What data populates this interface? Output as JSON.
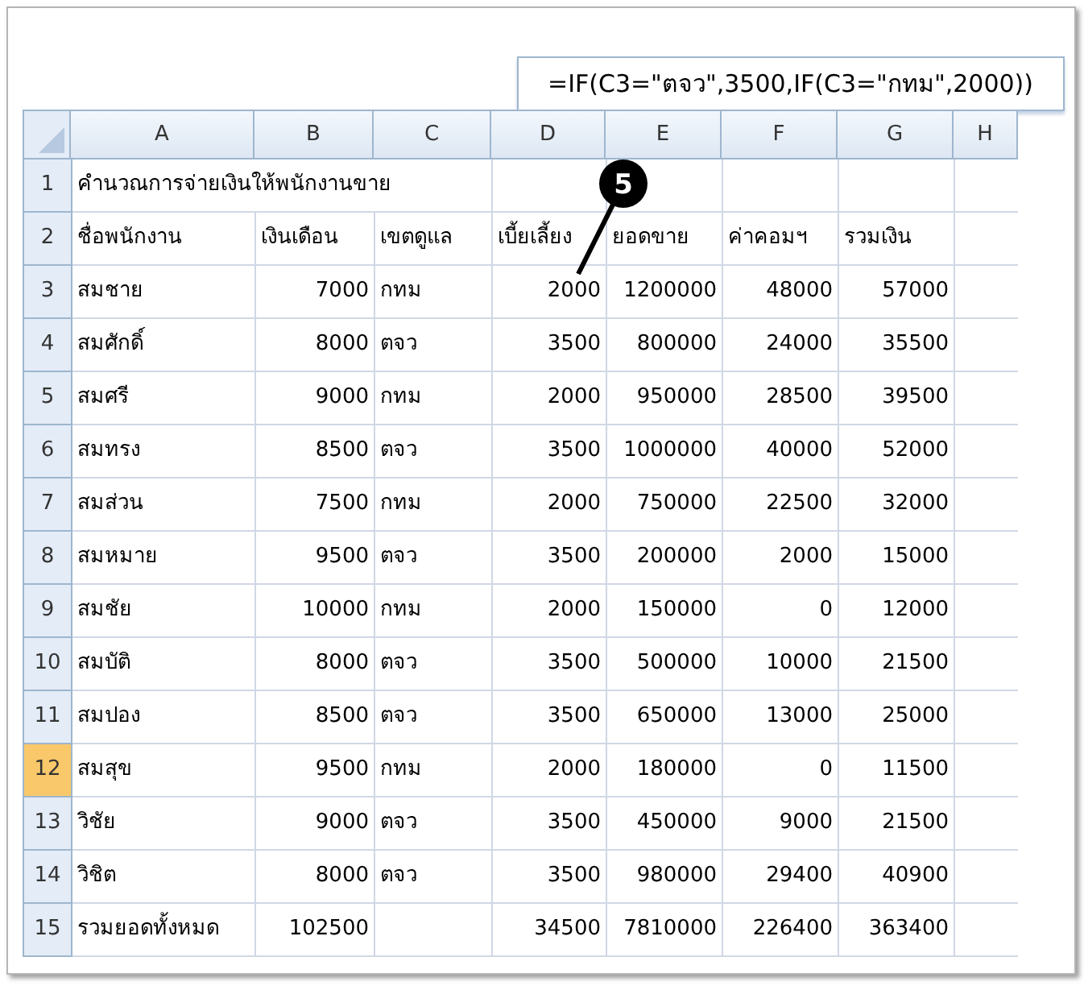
{
  "formula_bar": {
    "formula": "=IF(C3=\"ตจว\",3500,IF(C3=\"กทม\",2000))"
  },
  "sheet": {
    "columns": [
      "A",
      "B",
      "C",
      "D",
      "E",
      "F",
      "G",
      "H"
    ],
    "rows": [
      {
        "number": "1",
        "selected": false,
        "kind": "title",
        "cells": [
          {
            "text": "คำนวณการจ่ายเงินให้พนักงานขาย",
            "kind": "text"
          }
        ]
      },
      {
        "number": "2",
        "selected": false,
        "kind": "header",
        "cells": [
          {
            "text": "ชื่อพนักงาน",
            "kind": "text"
          },
          {
            "text": "เงินเดือน",
            "kind": "text"
          },
          {
            "text": "เขตดูแล",
            "kind": "text"
          },
          {
            "text": "เบี้ยเลี้ยง",
            "kind": "text"
          },
          {
            "text": "ยอดขาย",
            "kind": "text"
          },
          {
            "text": "ค่าคอมฯ",
            "kind": "text"
          },
          {
            "text": "รวมเงิน",
            "kind": "text"
          },
          null
        ]
      },
      {
        "number": "3",
        "selected": false,
        "kind": "data",
        "cells": [
          {
            "text": "สมชาย",
            "kind": "text"
          },
          {
            "text": "7000",
            "kind": "number"
          },
          {
            "text": "กทม",
            "kind": "text"
          },
          {
            "text": "2000",
            "kind": "number"
          },
          {
            "text": "1200000",
            "kind": "number"
          },
          {
            "text": "48000",
            "kind": "number"
          },
          {
            "text": "57000",
            "kind": "number"
          },
          null
        ]
      },
      {
        "number": "4",
        "selected": false,
        "kind": "data",
        "cells": [
          {
            "text": "สมศักดิ์",
            "kind": "text"
          },
          {
            "text": "8000",
            "kind": "number"
          },
          {
            "text": "ตจว",
            "kind": "text"
          },
          {
            "text": "3500",
            "kind": "number"
          },
          {
            "text": "800000",
            "kind": "number"
          },
          {
            "text": "24000",
            "kind": "number"
          },
          {
            "text": "35500",
            "kind": "number"
          },
          null
        ]
      },
      {
        "number": "5",
        "selected": false,
        "kind": "data",
        "cells": [
          {
            "text": "สมศรี",
            "kind": "text"
          },
          {
            "text": "9000",
            "kind": "number"
          },
          {
            "text": "กทม",
            "kind": "text"
          },
          {
            "text": "2000",
            "kind": "number"
          },
          {
            "text": "950000",
            "kind": "number"
          },
          {
            "text": "28500",
            "kind": "number"
          },
          {
            "text": "39500",
            "kind": "number"
          },
          null
        ]
      },
      {
        "number": "6",
        "selected": false,
        "kind": "data",
        "cells": [
          {
            "text": "สมทรง",
            "kind": "text"
          },
          {
            "text": "8500",
            "kind": "number"
          },
          {
            "text": "ตจว",
            "kind": "text"
          },
          {
            "text": "3500",
            "kind": "number"
          },
          {
            "text": "1000000",
            "kind": "number"
          },
          {
            "text": "40000",
            "kind": "number"
          },
          {
            "text": "52000",
            "kind": "number"
          },
          null
        ]
      },
      {
        "number": "7",
        "selected": false,
        "kind": "data",
        "cells": [
          {
            "text": "สมส่วน",
            "kind": "text"
          },
          {
            "text": "7500",
            "kind": "number"
          },
          {
            "text": "กทม",
            "kind": "text"
          },
          {
            "text": "2000",
            "kind": "number"
          },
          {
            "text": "750000",
            "kind": "number"
          },
          {
            "text": "22500",
            "kind": "number"
          },
          {
            "text": "32000",
            "kind": "number"
          },
          null
        ]
      },
      {
        "number": "8",
        "selected": false,
        "kind": "data",
        "cells": [
          {
            "text": "สมหมาย",
            "kind": "text"
          },
          {
            "text": "9500",
            "kind": "number"
          },
          {
            "text": "ตจว",
            "kind": "text"
          },
          {
            "text": "3500",
            "kind": "number"
          },
          {
            "text": "200000",
            "kind": "number"
          },
          {
            "text": "2000",
            "kind": "number"
          },
          {
            "text": "15000",
            "kind": "number"
          },
          null
        ]
      },
      {
        "number": "9",
        "selected": false,
        "kind": "data",
        "cells": [
          {
            "text": "สมชัย",
            "kind": "text"
          },
          {
            "text": "10000",
            "kind": "number"
          },
          {
            "text": "กทม",
            "kind": "text"
          },
          {
            "text": "2000",
            "kind": "number"
          },
          {
            "text": "150000",
            "kind": "number"
          },
          {
            "text": "0",
            "kind": "number"
          },
          {
            "text": "12000",
            "kind": "number"
          },
          null
        ]
      },
      {
        "number": "10",
        "selected": false,
        "kind": "data",
        "cells": [
          {
            "text": "สมบัติ",
            "kind": "text"
          },
          {
            "text": "8000",
            "kind": "number"
          },
          {
            "text": "ตจว",
            "kind": "text"
          },
          {
            "text": "3500",
            "kind": "number"
          },
          {
            "text": "500000",
            "kind": "number"
          },
          {
            "text": "10000",
            "kind": "number"
          },
          {
            "text": "21500",
            "kind": "number"
          },
          null
        ]
      },
      {
        "number": "11",
        "selected": false,
        "kind": "data",
        "cells": [
          {
            "text": "สมปอง",
            "kind": "text"
          },
          {
            "text": "8500",
            "kind": "number"
          },
          {
            "text": "ตจว",
            "kind": "text"
          },
          {
            "text": "3500",
            "kind": "number"
          },
          {
            "text": "650000",
            "kind": "number"
          },
          {
            "text": "13000",
            "kind": "number"
          },
          {
            "text": "25000",
            "kind": "number"
          },
          null
        ]
      },
      {
        "number": "12",
        "selected": true,
        "kind": "data",
        "cells": [
          {
            "text": "สมสุข",
            "kind": "text"
          },
          {
            "text": "9500",
            "kind": "number"
          },
          {
            "text": "กทม",
            "kind": "text"
          },
          {
            "text": "2000",
            "kind": "number"
          },
          {
            "text": "180000",
            "kind": "number"
          },
          {
            "text": "0",
            "kind": "number"
          },
          {
            "text": "11500",
            "kind": "number"
          },
          null
        ]
      },
      {
        "number": "13",
        "selected": false,
        "kind": "data",
        "cells": [
          {
            "text": "วิชัย",
            "kind": "text"
          },
          {
            "text": "9000",
            "kind": "number"
          },
          {
            "text": "ตจว",
            "kind": "text"
          },
          {
            "text": "3500",
            "kind": "number"
          },
          {
            "text": "450000",
            "kind": "number"
          },
          {
            "text": "9000",
            "kind": "number"
          },
          {
            "text": "21500",
            "kind": "number"
          },
          null
        ]
      },
      {
        "number": "14",
        "selected": false,
        "kind": "data",
        "cells": [
          {
            "text": "วิชิต",
            "kind": "text"
          },
          {
            "text": "8000",
            "kind": "number"
          },
          {
            "text": "ตจว",
            "kind": "text"
          },
          {
            "text": "3500",
            "kind": "number"
          },
          {
            "text": "980000",
            "kind": "number"
          },
          {
            "text": "29400",
            "kind": "number"
          },
          {
            "text": "40900",
            "kind": "number"
          },
          null
        ]
      },
      {
        "number": "15",
        "selected": false,
        "kind": "data",
        "cells": [
          {
            "text": "รวมยอดทั้งหมด",
            "kind": "text"
          },
          {
            "text": "102500",
            "kind": "number"
          },
          null,
          {
            "text": "34500",
            "kind": "number"
          },
          {
            "text": "7810000",
            "kind": "number"
          },
          {
            "text": "226400",
            "kind": "number"
          },
          {
            "text": "363400",
            "kind": "number"
          },
          null
        ]
      }
    ]
  },
  "callout": {
    "label": "5"
  }
}
